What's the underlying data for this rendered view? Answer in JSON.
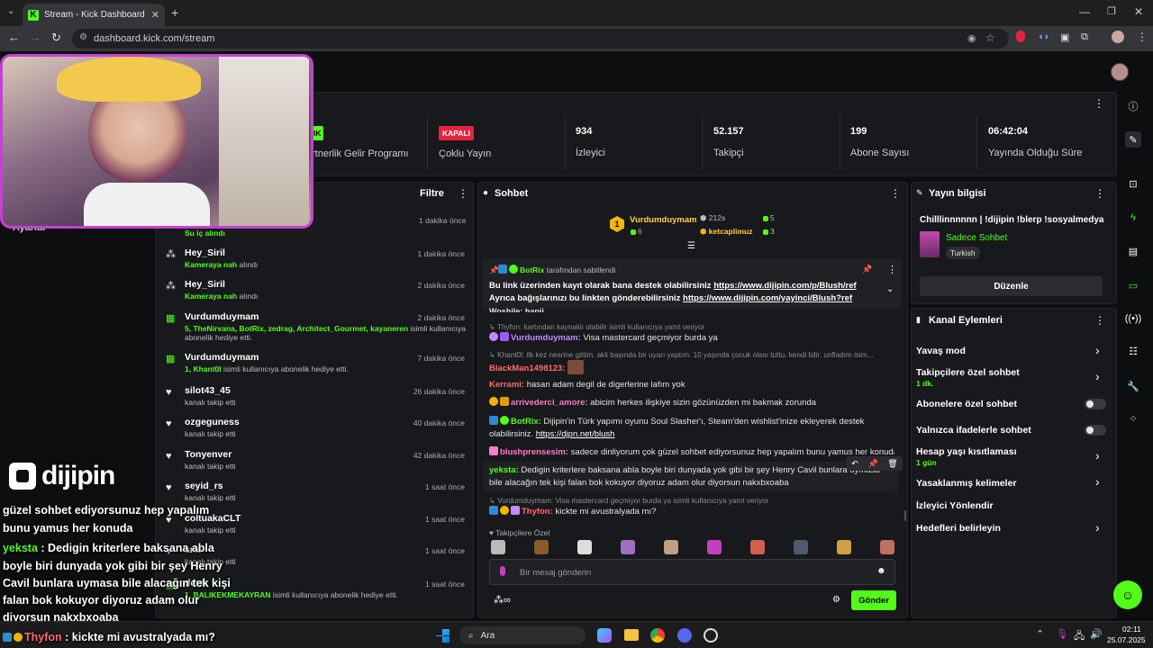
{
  "browser": {
    "tab_title": "Stream - Kick Dashboard",
    "url": "dashboard.kick.com/stream"
  },
  "stats": {
    "partner_badge": "IK",
    "partner_label": "rtnerlik Gelir Programı",
    "multistream_badge": "KAPALI",
    "multistream_label": "Çoklu Yayın",
    "viewers_value": "934",
    "viewers_label": "İzleyici",
    "followers_value": "52.157",
    "followers_label": "Takipçi",
    "subs_value": "199",
    "subs_label": "Abone Sayısı",
    "uptime_value": "06:42:04",
    "uptime_label": "Yayında Olduğu Süre"
  },
  "activity": {
    "filter_label": "Filtre",
    "partial_label": "Ayarlar",
    "first_time": "1 dakika önce",
    "first_sub": "Su iç alındı",
    "rows": [
      {
        "name": "Hey_Siril",
        "sub_hl": "Kameraya nah",
        "sub": " alındı",
        "time": "1 dakika önce",
        "icon": "gift"
      },
      {
        "name": "Hey_Siril",
        "sub_hl": "Kameraya nah",
        "sub": " alındı",
        "time": "2 dakika önce",
        "icon": "gift"
      },
      {
        "name": "Vurdumduymam",
        "sub_hl": "5, TheNirvana, BotRix, zedrag, Architect_Gourmet, kayaneren",
        "sub": " isimli kullanıcıya",
        "sub2": "abonelik hediye etti.",
        "time": "2 dakika önce",
        "icon": "sub"
      },
      {
        "name": "Vurdumduymam",
        "sub_hl": "1, Khant0l",
        "sub": " isimli kullanıcıya abonelik hediye etti.",
        "time": "7 dakika önce",
        "icon": "sub"
      },
      {
        "name": "silot43_45",
        "sub_hl": "",
        "sub": "kanalı takip etti",
        "time": "26 dakika önce",
        "icon": "heart"
      },
      {
        "name": "ozgeguness",
        "sub_hl": "",
        "sub": "kanalı takip etti",
        "time": "40 dakika önce",
        "icon": "heart"
      },
      {
        "name": "Tonyenver",
        "sub_hl": "",
        "sub": "kanalı takip etti",
        "time": "42 dakika önce",
        "icon": "heart"
      },
      {
        "name": "seyid_rs",
        "sub_hl": "",
        "sub": "kanalı takip etti",
        "time": "1 saat önce",
        "icon": "heart"
      },
      {
        "name": "coltuakaCLT",
        "sub_hl": "",
        "sub": "kanalı takip etti",
        "time": "1 saat önce",
        "icon": "heart"
      },
      {
        "name": "arts",
        "sub_hl": "",
        "sub": "kanalı takip etti",
        "time": "1 saat önce",
        "icon": "heart"
      },
      {
        "name": "dent",
        "sub_hl": "1, BALIKEKMEKAYRAN",
        "sub": " isimli kullanıcıya abonelik hediye etti.",
        "time": "1 saat önce",
        "icon": "sub"
      }
    ]
  },
  "chat": {
    "title": "Sohbet",
    "top_gifter": {
      "name": "Vurdumduymam",
      "count": "6",
      "rank": "1"
    },
    "top_other": {
      "time": "212s",
      "count1": "5",
      "name": "ketcaplimuz",
      "count2": "3"
    },
    "pinned_by": "BotRix",
    "pinned_suffix": "tarafından sabitlendi",
    "pinned_line1": "Bu link üzerinden kayıt olarak bana destek olabilirsiniz",
    "pinned_link1": "https://www.dijipin.com/p/Blush/ref",
    "pinned_line2": "Ayrıca bağışlarınızı bu linkten gönderebilirsiniz",
    "pinned_link2": "https://www.dijipin.com/yayinci/Blush?ref",
    "partial_top": "Woshile: hapii",
    "reply1": "Thyfon: kartından kaynaklı olabilir isimli kullanıcıya yanıt veriyor",
    "m1_user": "Vurdumduymam:",
    "m1_text": " Visa mastercard geçmiyor burda ya",
    "reply2": "Khant0l: ilk kez nesrine gittim. akli başında bir uyarı yaptım. 10 yaşında çocuk olası tuttu. kendi bilir. unfladım isim...",
    "m2_user": "BlackMan1498123:",
    "m3_user": "Kerrami:",
    "m3_text": " hasan adam degil de digerlerine lafım yok",
    "m4_user": "arrivederci_amore:",
    "m4_text": " abicim herkes ilişkiye sizin gözünüzden mi bakmak zorunda",
    "m5_user": "BotRix:",
    "m5_text": " Dijipin'in Türk yapımı oyunu Soul Slasher'ı, Steam'den wishlist'inize ekleyerek destek olabilirsiniz.",
    "m5_link": "https://djpn.net/blush",
    "m6_user": "blushprensesim:",
    "m6_text": " sadece dinliyorum çok güzel sohbet ediyorsunuz hep yapalım bunu yamus her konuda",
    "m7_user": "yeksta:",
    "m7_text": " Dedigin kriterlere baksana abla boyle biri dunyada yok gibi bir şey Henry Cavil bunlara uymasa bile alacağın tek kişi falan bok kokuyor diyoruz adam olur diyorsun nakxbxoaba",
    "reply3": "Vurdumduymam: Visa mastercard geçmiyor burda ya isimli kullanıcıya yanıt veriyor",
    "m8_user": "Thyfon:",
    "m8_text": " kickte mi avustralyada mı?",
    "emote_section": "Takipçilere Özel",
    "input_placeholder": "Bir mesaj gönderin",
    "send_label": "Gönder"
  },
  "stream_info": {
    "title": "Yayın bilgisi",
    "stream_title": "Chilllinnnnnn | !dijipin !blerp !sosyalmedya",
    "category": "Sadece Sohbet",
    "tag": "Turkish",
    "edit_label": "Düzenle"
  },
  "channel_actions": {
    "title": "Kanal Eylemleri",
    "slow_mode": "Yavaş mod",
    "followers_only": "Takipçilere özel sohbet",
    "followers_only_sub": "1 dk.",
    "subs_only": "Abonelere özel sohbet",
    "emotes_only": "Yalnızca ifadelerle sohbet",
    "account_age": "Hesap yaşı kısıtlaması",
    "account_age_sub": "1 gün",
    "banned_words": "Yasaklanmış kelimeler",
    "viewer_redirect": "İzleyici Yönlendir",
    "set_goals": "Hedefleri belirleyin"
  },
  "overlay": {
    "brand": "dijipin",
    "line1": "güzel sohbet ediyorsunuz hep yapalım",
    "line2": "bunu yamus her konuda",
    "line3_user": "yeksta",
    "line3": " : Dedigin kriterlere baksana abla",
    "line4": "boyle biri dunyada yok gibi bir şey Henry",
    "line5": "Cavil bunlara uymasa bile alacağın tek kişi",
    "line6": "falan bok kokuyor diyoruz adam olur",
    "line7": "diyorsun nakxbxoaba",
    "line8_user": "Thyfon",
    "line8": " : kickte mi avustralyada mı?"
  },
  "taskbar": {
    "search_label": "Ara",
    "time": "02:11",
    "date": "25.07.2025"
  },
  "colors": {
    "kick_green": "#53fc18",
    "cam_border": "#c93fd6",
    "danger": "#e5243b"
  }
}
